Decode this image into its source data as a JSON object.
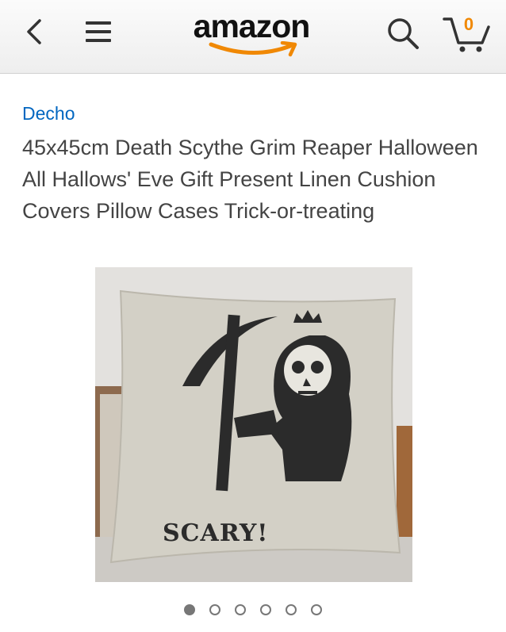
{
  "header": {
    "logo_text": "amazon",
    "cart_count": "0",
    "accent_color": "#f08804"
  },
  "product": {
    "brand": "Decho",
    "title": "45x45cm Death Scythe Grim Reaper Halloween All Hallows' Eve Gift Present Linen Cushion Covers Pillow Cases Trick-or-treating",
    "image_text": "SCARY!"
  },
  "carousel": {
    "count": 6,
    "active_index": 0
  }
}
